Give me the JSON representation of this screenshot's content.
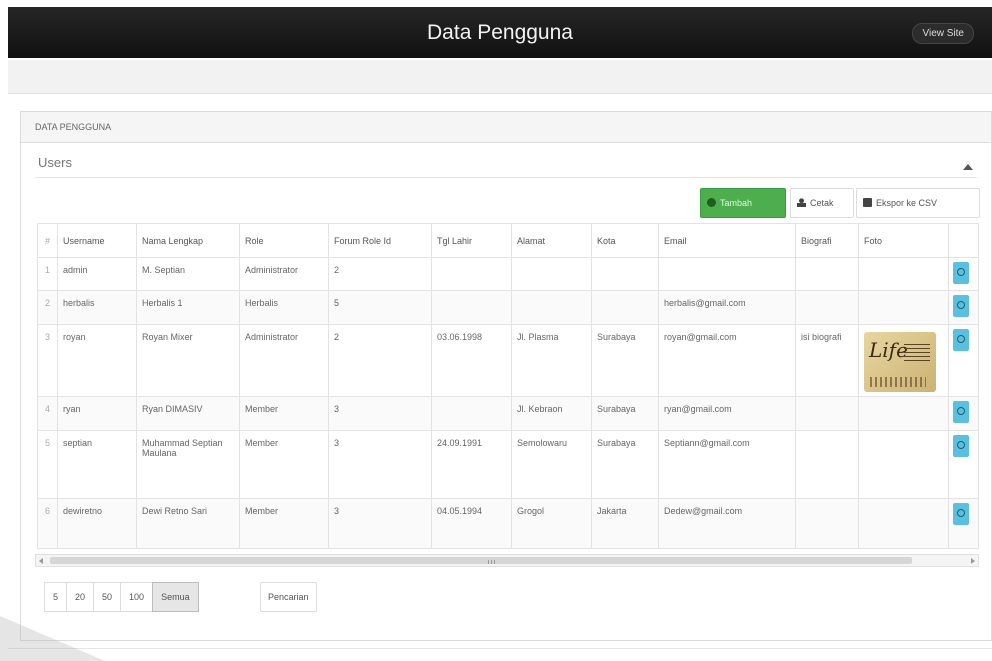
{
  "header": {
    "title": "Data Pengguna",
    "view_site": "View Site"
  },
  "panel": {
    "heading": "DATA PENGGUNA",
    "users_title": "Users"
  },
  "toolbar": {
    "add": "Tambah",
    "print": "Cetak",
    "csv": "Ekspor ke CSV"
  },
  "table": {
    "columns": [
      "#",
      "Username",
      "Nama Lengkap",
      "Role",
      "Forum Role Id",
      "Tgl Lahir",
      "Alamat",
      "Kota",
      "Email",
      "Biografi",
      "Foto",
      ""
    ],
    "rows": [
      {
        "no": "1",
        "username": "admin",
        "nama": "M. Septian",
        "role": "Administrator",
        "forum_role_id": "2",
        "tgl_lahir": "",
        "alamat": "",
        "kota": "",
        "email": "",
        "biografi": "",
        "foto": false
      },
      {
        "no": "2",
        "username": "herbalis",
        "nama": "Herbalis 1",
        "role": "Herbalis",
        "forum_role_id": "5",
        "tgl_lahir": "",
        "alamat": "",
        "kota": "",
        "email": "herbalis@gmail.com",
        "biografi": "",
        "foto": false
      },
      {
        "no": "3",
        "username": "royan",
        "nama": "Royan Mixer",
        "role": "Administrator",
        "forum_role_id": "2",
        "tgl_lahir": "03.06.1998",
        "alamat": "Jl. Plasma",
        "kota": "Surabaya",
        "email": "royan@gmail.com",
        "biografi": "isi biografi",
        "foto": true
      },
      {
        "no": "4",
        "username": "ryan",
        "nama": "Ryan DIMASIV",
        "role": "Member",
        "forum_role_id": "3",
        "tgl_lahir": "",
        "alamat": "Jl. Kebraon",
        "kota": "Surabaya",
        "email": "ryan@gmail.com",
        "biografi": "",
        "foto": false
      },
      {
        "no": "5",
        "username": "septian",
        "nama": "Muhammad Septian Maulana",
        "role": "Member",
        "forum_role_id": "3",
        "tgl_lahir": "24.09.1991",
        "alamat": "Semolowaru",
        "kota": "Surabaya",
        "email": "Septiann@gmail.com",
        "biografi": "",
        "foto": false
      },
      {
        "no": "6",
        "username": "dewiretno",
        "nama": "Dewi Retno Sari",
        "role": "Member",
        "forum_role_id": "3",
        "tgl_lahir": "04.05.1994",
        "alamat": "Grogol",
        "kota": "Jakarta",
        "email": "Dedew@gmail.com",
        "biografi": "",
        "foto": false
      }
    ]
  },
  "photo_text": "Life",
  "pager": {
    "sizes": [
      "5",
      "20",
      "50",
      "100",
      "Semua"
    ],
    "active": "Semua",
    "search": "Pencarian"
  }
}
